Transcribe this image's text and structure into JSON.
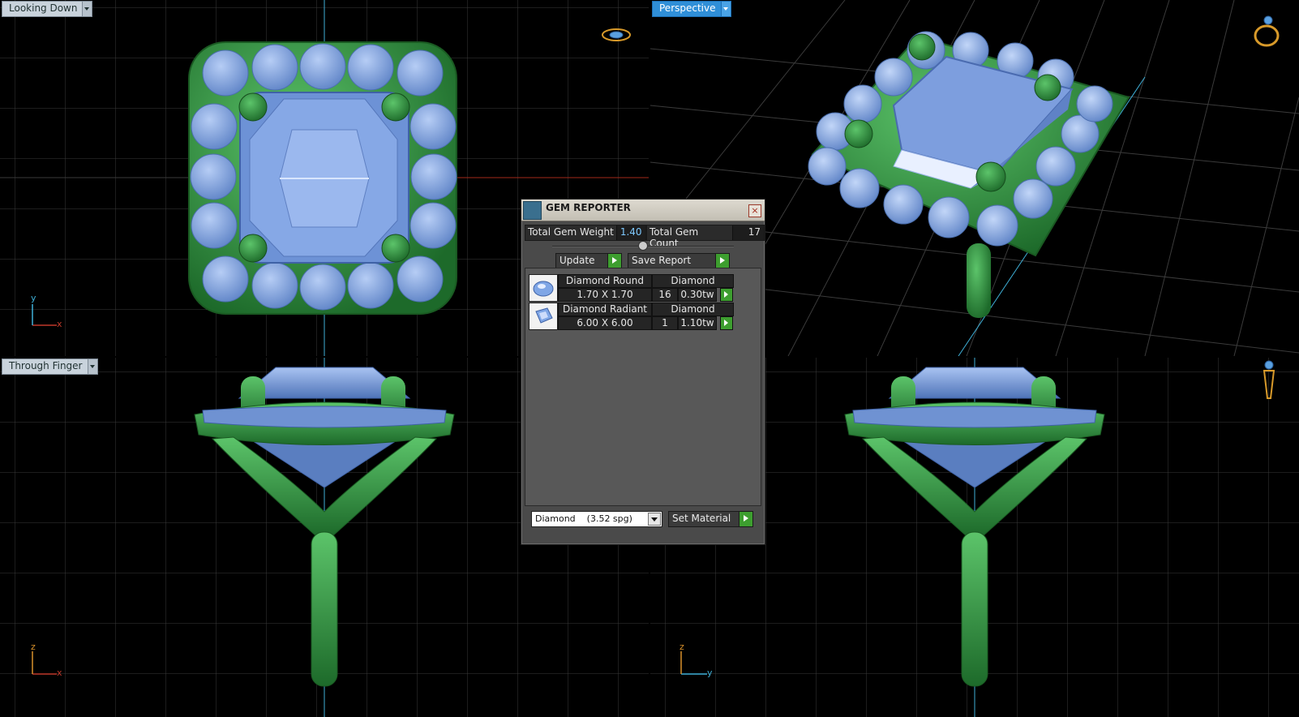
{
  "viewports": {
    "top_left": {
      "label": "Looking Down",
      "axis1": "y",
      "axis2": "x"
    },
    "top_right": {
      "label": "Perspective"
    },
    "bottom_left": {
      "label": "Through Finger",
      "axis1": "z",
      "axis2": "x"
    },
    "bottom_right": {
      "axis1": "z",
      "axis2": "y"
    }
  },
  "gem_reporter": {
    "title": "GEM REPORTER",
    "close": "×",
    "total_weight_label": "Total Gem Weight",
    "total_weight_value": "1.40",
    "total_count_label": "Total Gem Count",
    "total_count_value": "17",
    "update_label": "Update",
    "save_report_label": "Save Report",
    "gems": [
      {
        "shape": "Diamond Round",
        "material": "Diamond",
        "size": "1.70 X 1.70",
        "count": "16",
        "weight": "0.30tw"
      },
      {
        "shape": "Diamond Radiant",
        "material": "Diamond",
        "size": "6.00 X 6.00",
        "count": "1",
        "weight": "1.10tw"
      }
    ],
    "material_select": "Diamond    (3.52 spg)",
    "set_material_label": "Set Material"
  },
  "colors": {
    "metal": "#2f8f3a",
    "gem": "#7fa6e6",
    "grid": "#3a3a3a",
    "axis": "#3fb0d8",
    "accent": "#2f8fd8"
  },
  "icons": [
    "ring-view-icon",
    "ring-perspective-icon",
    "ring-side-icon",
    "gem-reporter-logo-icon",
    "close-icon"
  ]
}
